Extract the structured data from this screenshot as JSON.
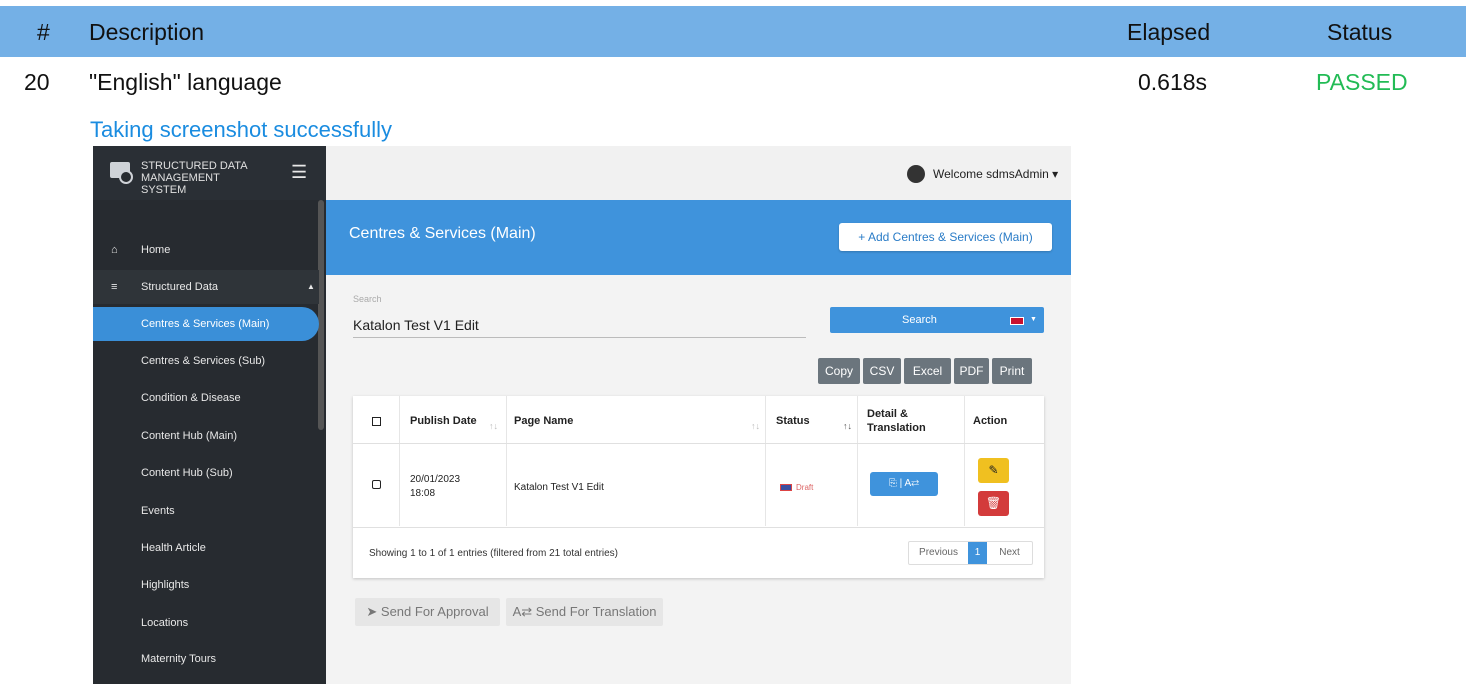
{
  "report": {
    "headers": {
      "num": "#",
      "description": "Description",
      "elapsed": "Elapsed",
      "status": "Status"
    },
    "row": {
      "num": "20",
      "description": "\"English\" language",
      "elapsed": "0.618s",
      "status": "PASSED"
    },
    "screenshot_link": "Taking screenshot successfully"
  },
  "app": {
    "brand_line1": "STRUCTURED DATA",
    "brand_line2": "MANAGEMENT SYSTEM",
    "welcome": "Welcome sdmsAdmin",
    "sidebar": {
      "home": "Home",
      "group": "Structured Data",
      "items": [
        "Centres & Services (Main)",
        "Centres & Services (Sub)",
        "Condition & Disease",
        "Content Hub (Main)",
        "Content Hub (Sub)",
        "Events",
        "Health Article",
        "Highlights",
        "Locations",
        "Maternity Tours"
      ]
    },
    "page_title": "Centres & Services (Main)",
    "add_button": "Add Centres & Services (Main)",
    "search": {
      "label": "Search",
      "value": "Katalon Test V1 Edit",
      "button": "Search"
    },
    "export_buttons": [
      "Copy",
      "CSV",
      "Excel",
      "PDF",
      "Print"
    ],
    "table": {
      "headers": {
        "publish_date": "Publish Date",
        "page_name": "Page Name",
        "status": "Status",
        "detail_line1": "Detail &",
        "detail_line2": "Translation",
        "action": "Action"
      },
      "row": {
        "date_line1": "20/01/2023",
        "date_line2": "18:08",
        "page_name": "Katalon Test V1 Edit",
        "status": "Draft"
      },
      "info": "Showing 1 to 1 of 1 entries (filtered from 21 total entries)",
      "pager": {
        "previous": "Previous",
        "page": "1",
        "next": "Next"
      }
    },
    "actions": {
      "approval": "Send For Approval",
      "translation": "Send For Translation"
    }
  }
}
